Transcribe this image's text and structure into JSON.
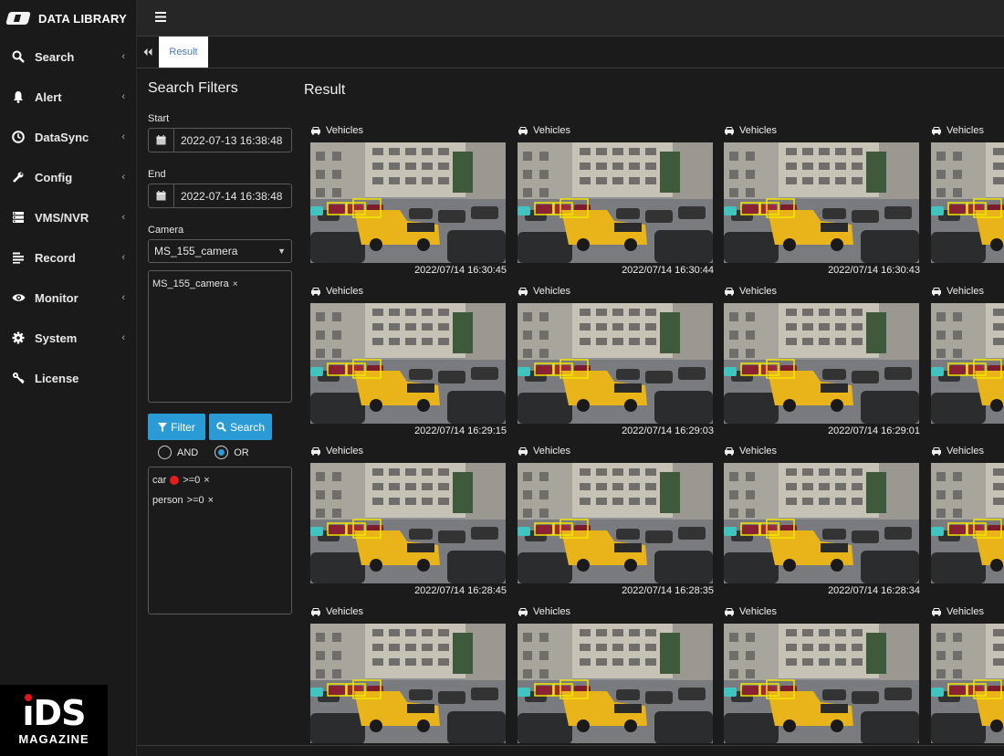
{
  "brand": {
    "title": "DATA LIBRARY"
  },
  "sidebar": {
    "items": [
      {
        "label": "Search",
        "icon": "search-icon",
        "has_chevron": true
      },
      {
        "label": "Alert",
        "icon": "bell-icon",
        "has_chevron": true
      },
      {
        "label": "DataSync",
        "icon": "clock-icon",
        "has_chevron": true
      },
      {
        "label": "Config",
        "icon": "wrench-icon",
        "has_chevron": true
      },
      {
        "label": "VMS/NVR",
        "icon": "server-icon",
        "has_chevron": true
      },
      {
        "label": "Record",
        "icon": "record-list-icon",
        "has_chevron": true
      },
      {
        "label": "Monitor",
        "icon": "eye-icon",
        "has_chevron": true
      },
      {
        "label": "System",
        "icon": "gear-icon",
        "has_chevron": true
      },
      {
        "label": "License",
        "icon": "key-icon",
        "has_chevron": false
      }
    ]
  },
  "tabs": [
    {
      "label": "Result",
      "active": true
    }
  ],
  "filters": {
    "title": "Search Filters",
    "start_label": "Start",
    "start_value": "2022-07-13 16:38:48",
    "end_label": "End",
    "end_value": "2022-07-14 16:38:48",
    "camera_label": "Camera",
    "camera_selected": "MS_155_camera",
    "camera_chips": [
      "MS_155_camera"
    ],
    "filter_button": "Filter",
    "search_button": "Search",
    "logic": {
      "and_label": "AND",
      "or_label": "OR",
      "selected": "OR"
    },
    "conditions": [
      {
        "object": "car",
        "color": "#e51c1c",
        "rule": ">=0"
      },
      {
        "object": "person",
        "rule": ">=0"
      }
    ]
  },
  "result": {
    "title": "Result",
    "category_label": "Vehicles",
    "timestamps": [
      [
        "2022/07/14 16:30:45",
        "2022/07/14 16:30:44",
        "2022/07/14 16:30:43",
        ""
      ],
      [
        "2022/07/14 16:29:15",
        "2022/07/14 16:29:03",
        "2022/07/14 16:29:01",
        ""
      ],
      [
        "2022/07/14 16:28:45",
        "2022/07/14 16:28:35",
        "2022/07/14 16:28:34",
        ""
      ],
      [
        "",
        "",
        "",
        ""
      ]
    ]
  },
  "watermark": {
    "logo_text": "iDS",
    "logo_sub": "MAGAZINE"
  },
  "colors": {
    "accent": "#2b9bd6",
    "detection_box": "#f2e600",
    "van": "#e9b419"
  }
}
